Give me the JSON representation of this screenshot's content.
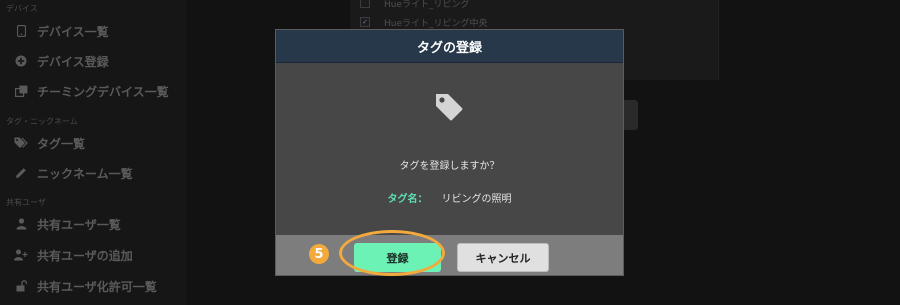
{
  "sidebar": {
    "sections": [
      {
        "label": "デバイス"
      },
      {
        "label": "タグ・ニックネーム"
      },
      {
        "label": "共有ユーザ"
      }
    ],
    "items": [
      {
        "label": "デバイス一覧",
        "icon": "phone-icon"
      },
      {
        "label": "デバイス登録",
        "icon": "plus-circle-icon"
      },
      {
        "label": "チーミングデバイス一覧",
        "icon": "clone-icon"
      },
      {
        "label": "タグ一覧",
        "icon": "tags-icon"
      },
      {
        "label": "ニックネーム一覧",
        "icon": "pencil-icon"
      },
      {
        "label": "共有ユーザ一覧",
        "icon": "user-icon"
      },
      {
        "label": "共有ユーザの追加",
        "icon": "user-plus-icon"
      },
      {
        "label": "共有ユーザ化許可一覧",
        "icon": "lock-open-icon"
      }
    ]
  },
  "device_list": {
    "rows": [
      {
        "label": "Hueライト_リビング",
        "checked": false
      },
      {
        "label": "Hueライト_リビング中央",
        "checked": true
      }
    ]
  },
  "modal": {
    "title": "タグの登録",
    "icon": "tag-icon",
    "question": "タグを登録しますか？",
    "tag_name_label": "タグ名：",
    "tag_name_value": "リビングの照明",
    "register_label": "登録",
    "cancel_label": "キャンセル"
  },
  "annotation": {
    "step_number": "5",
    "color": "#f3a93c"
  },
  "colors": {
    "modal_header": "#26384a",
    "accent_green": "#6cf2b4",
    "tag_label": "#5fe0b2"
  }
}
